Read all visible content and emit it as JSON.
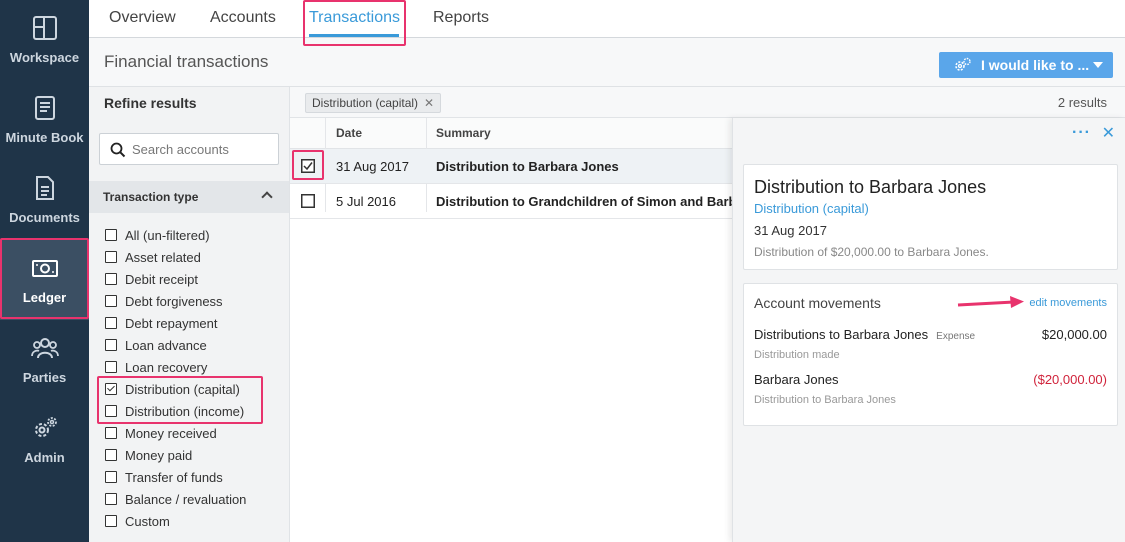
{
  "sidebar": {
    "items": [
      {
        "label": "Workspace",
        "icon": "workspace-icon"
      },
      {
        "label": "Minute Book",
        "icon": "book-icon"
      },
      {
        "label": "Documents",
        "icon": "document-icon"
      },
      {
        "label": "Ledger",
        "icon": "banknote-icon",
        "active": true
      },
      {
        "label": "Parties",
        "icon": "people-icon"
      },
      {
        "label": "Admin",
        "icon": "gear-icon"
      }
    ]
  },
  "topnav": {
    "tabs": [
      "Overview",
      "Accounts",
      "Transactions",
      "Reports"
    ],
    "active": "Transactions"
  },
  "header": {
    "title": "Financial transactions",
    "action_label": "I would like to ..."
  },
  "refine": {
    "title": "Refine results",
    "search_placeholder": "Search accounts",
    "section_title": "Transaction type",
    "filters": [
      {
        "label": "All (un-filtered)",
        "checked": false
      },
      {
        "label": "Asset related",
        "checked": false
      },
      {
        "label": "Debit receipt",
        "checked": false
      },
      {
        "label": "Debt forgiveness",
        "checked": false
      },
      {
        "label": "Debt repayment",
        "checked": false
      },
      {
        "label": "Loan advance",
        "checked": false
      },
      {
        "label": "Loan recovery",
        "checked": false
      },
      {
        "label": "Distribution (capital)",
        "checked": true
      },
      {
        "label": "Distribution (income)",
        "checked": false
      },
      {
        "label": "Money received",
        "checked": false
      },
      {
        "label": "Money paid",
        "checked": false
      },
      {
        "label": "Transfer of funds",
        "checked": false
      },
      {
        "label": "Balance / revaluation",
        "checked": false
      },
      {
        "label": "Custom",
        "checked": false
      }
    ]
  },
  "results": {
    "chip": "Distribution (capital)",
    "count": "2 results",
    "columns": {
      "date": "Date",
      "summary": "Summary"
    },
    "rows": [
      {
        "date": "31 Aug 2017",
        "summary": "Distribution to Barbara Jones",
        "selected": true
      },
      {
        "date": "5 Jul 2016",
        "summary": "Distribution to Grandchildren of Simon and Barb...",
        "selected": false
      }
    ]
  },
  "detail": {
    "more": "···",
    "close": "✕",
    "title": "Distribution to Barbara Jones",
    "type": "Distribution (capital)",
    "date": "31 Aug 2017",
    "description": "Distribution of $20,000.00 to Barbara Jones.",
    "movements_title": "Account movements",
    "edit_label": "edit movements",
    "movements": [
      {
        "name": "Distributions to Barbara Jones",
        "tag": "Expense",
        "amount": "$20,000.00",
        "sub": "Distribution made"
      },
      {
        "name": "Barbara Jones",
        "tag": "",
        "amount": "($20,000.00)",
        "sub": "Distribution to Barbara Jones"
      }
    ]
  },
  "colors": {
    "accent": "#3a9ad9",
    "highlight": "#e8336d",
    "sidebar": "#1f3448",
    "negative": "#d0233b"
  }
}
